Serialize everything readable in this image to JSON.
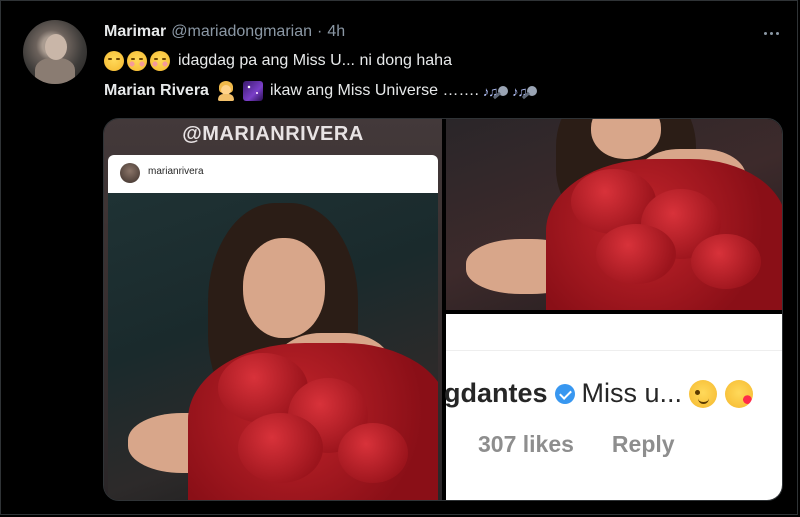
{
  "tweet": {
    "display_name": "Marimar",
    "handle": "@mariadongmarian",
    "separator": "·",
    "time": "4h",
    "line1_text": "idagdag pa ang Miss U... ni dong haha",
    "line2_name": "Marian Rivera",
    "line2_text": "ikaw ang Miss Universe …….",
    "icons": {
      "more": "more-horizontal-icon",
      "line1": [
        "winking-face-icon",
        "smiling-blush-face-icon",
        "smiling-blush-face-icon"
      ],
      "line2": [
        "princess-icon",
        "night-sky-icon",
        "music-notes-microphone-icon",
        "music-notes-microphone-icon"
      ]
    }
  },
  "media": {
    "left_tag": "@MARIANRIVERA",
    "ig_username": "marianrivera",
    "comment": {
      "user": "gdantes",
      "text": "Miss u...",
      "likes": "307 likes",
      "reply": "Reply",
      "icons": [
        "verified-badge-icon",
        "winking-face-icon",
        "face-blowing-kiss-icon"
      ]
    }
  },
  "colors": {
    "background": "#000000",
    "text": "#e7e9ea",
    "secondary": "#8b98a5",
    "border": "#2f3336",
    "verified": "#3897f0"
  }
}
